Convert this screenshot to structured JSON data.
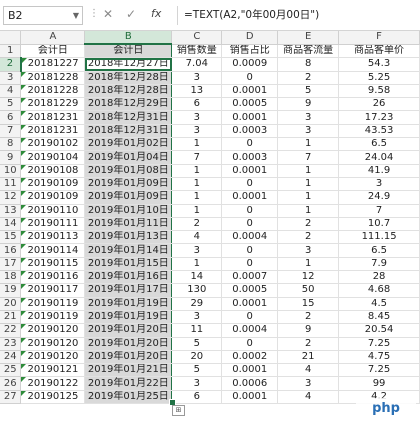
{
  "formula_bar": {
    "name_box": "B2",
    "formula": "=TEXT(A2,\"0年00月00日\")"
  },
  "columns": [
    "A",
    "B",
    "C",
    "D",
    "E",
    "F"
  ],
  "headers": [
    "会计日",
    "会计日",
    "销售数量",
    "销售占比",
    "商品客流量",
    "商品客单价"
  ],
  "rows": [
    [
      "20181227",
      "2018年12月27日",
      "7.04",
      "0.0009",
      "8",
      "54.3"
    ],
    [
      "20181228",
      "2018年12月28日",
      "3",
      "0",
      "2",
      "5.25"
    ],
    [
      "20181228",
      "2018年12月28日",
      "13",
      "0.0001",
      "5",
      "9.58"
    ],
    [
      "20181229",
      "2018年12月29日",
      "6",
      "0.0005",
      "9",
      "26"
    ],
    [
      "20181231",
      "2018年12月31日",
      "3",
      "0.0001",
      "3",
      "17.23"
    ],
    [
      "20181231",
      "2018年12月31日",
      "3",
      "0.0003",
      "3",
      "43.53"
    ],
    [
      "20190102",
      "2019年01月02日",
      "1",
      "0",
      "1",
      "6.5"
    ],
    [
      "20190104",
      "2019年01月04日",
      "7",
      "0.0003",
      "7",
      "24.04"
    ],
    [
      "20190108",
      "2019年01月08日",
      "1",
      "0.0001",
      "1",
      "41.9"
    ],
    [
      "20190109",
      "2019年01月09日",
      "1",
      "0",
      "1",
      "3"
    ],
    [
      "20190109",
      "2019年01月09日",
      "1",
      "0.0001",
      "1",
      "24.9"
    ],
    [
      "20190110",
      "2019年01月10日",
      "1",
      "0",
      "1",
      "7"
    ],
    [
      "20190111",
      "2019年01月11日",
      "2",
      "0",
      "2",
      "10.7"
    ],
    [
      "20190113",
      "2019年01月13日",
      "4",
      "0.0004",
      "2",
      "111.15"
    ],
    [
      "20190114",
      "2019年01月14日",
      "3",
      "0",
      "3",
      "6.5"
    ],
    [
      "20190115",
      "2019年01月15日",
      "1",
      "0",
      "1",
      "7.9"
    ],
    [
      "20190116",
      "2019年01月16日",
      "14",
      "0.0007",
      "12",
      "28"
    ],
    [
      "20190117",
      "2019年01月17日",
      "130",
      "0.0005",
      "50",
      "4.68"
    ],
    [
      "20190119",
      "2019年01月19日",
      "29",
      "0.0001",
      "15",
      "4.5"
    ],
    [
      "20190119",
      "2019年01月19日",
      "3",
      "0",
      "2",
      "8.45"
    ],
    [
      "20190120",
      "2019年01月20日",
      "11",
      "0.0004",
      "9",
      "20.54"
    ],
    [
      "20190120",
      "2019年01月20日",
      "5",
      "0",
      "2",
      "7.25"
    ],
    [
      "20190120",
      "2019年01月20日",
      "20",
      "0.0002",
      "21",
      "4.75"
    ],
    [
      "20190121",
      "2019年01月21日",
      "5",
      "0.0001",
      "4",
      "7.25"
    ],
    [
      "20190122",
      "2019年01月22日",
      "3",
      "0.0006",
      "3",
      "99"
    ],
    [
      "20190125",
      "2019年01月25日",
      "6",
      "0.0001",
      "4",
      "4.2"
    ]
  ],
  "paste_options_label": "⊞",
  "watermark": "php",
  "colors": {
    "accent": "#217346",
    "selection": "#d9d9d9"
  }
}
